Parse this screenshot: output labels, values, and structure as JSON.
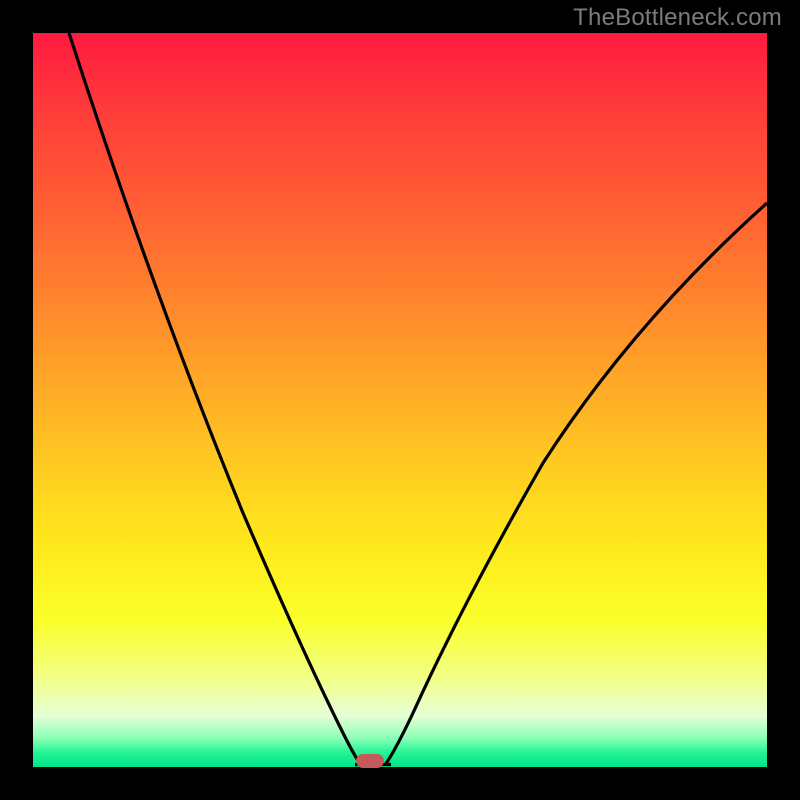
{
  "branding": {
    "watermark": "TheBottleneck.com"
  },
  "chart_data": {
    "type": "line",
    "title": "",
    "xlabel": "",
    "ylabel": "",
    "xlim": [
      0,
      100
    ],
    "ylim": [
      0,
      100
    ],
    "grid": false,
    "gradient_axis": "y",
    "gradient_stops": [
      {
        "pos": 0,
        "color": "#ff1a40"
      },
      {
        "pos": 50,
        "color": "#ffb325"
      },
      {
        "pos": 80,
        "color": "#fbff2a"
      },
      {
        "pos": 100,
        "color": "#00e38a"
      }
    ],
    "series": [
      {
        "name": "bottleneck-curve",
        "x": [
          0,
          5,
          10,
          15,
          20,
          25,
          30,
          35,
          40,
          43,
          45,
          47,
          50,
          55,
          60,
          65,
          70,
          75,
          80,
          85,
          90,
          95,
          100
        ],
        "values": [
          100,
          92,
          83,
          73,
          63,
          52,
          40,
          27,
          12,
          3,
          0,
          0,
          5,
          18,
          30,
          40,
          48,
          55,
          61,
          66,
          70,
          73,
          76
        ]
      }
    ],
    "marker": {
      "x": 46,
      "y": 0,
      "color": "#c65a5a"
    }
  }
}
